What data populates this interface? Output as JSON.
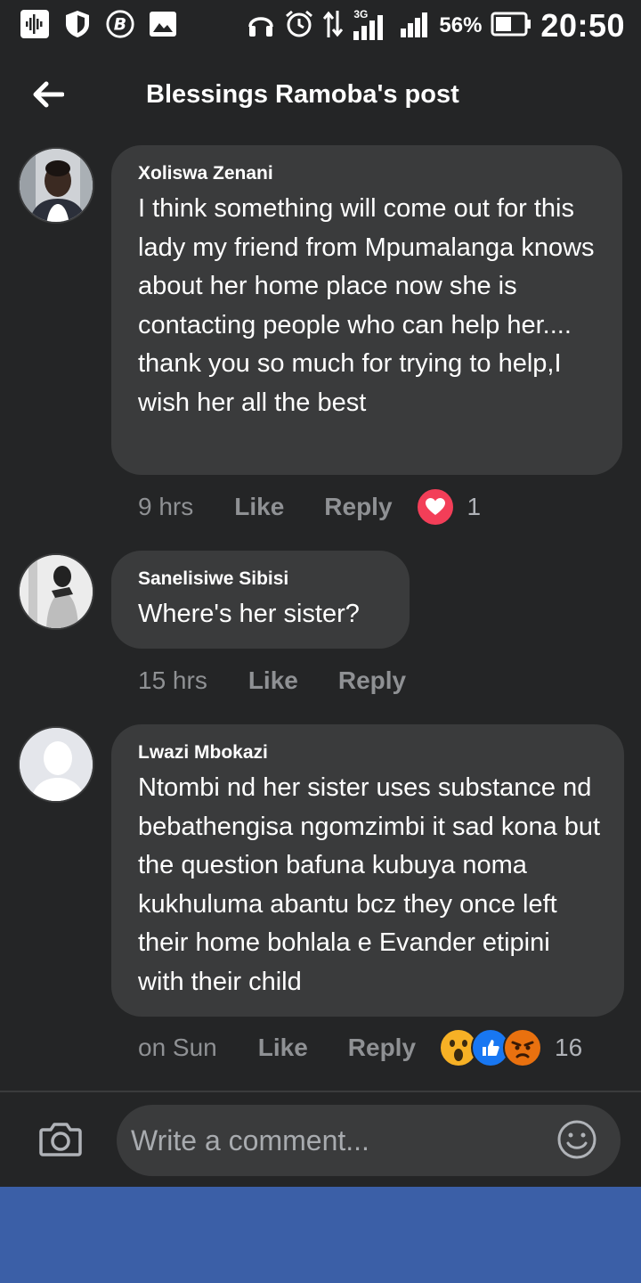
{
  "status_bar": {
    "network_label": "3G",
    "battery_percent": "56%",
    "battery_level": 0.56,
    "time": "20:50"
  },
  "header": {
    "title": "Blessings Ramoba's post",
    "back_icon": "arrow-left-icon"
  },
  "comments": [
    {
      "author": "Xoliswa Zenani",
      "text": "I think something will come out for this lady my friend from Mpumalanga knows about her home place now she is contacting people who can help her.... thank you so much for trying to help,I wish her all the best",
      "time": "9 hrs",
      "like_label": "Like",
      "reply_label": "Reply",
      "reactions": [
        "love"
      ],
      "reaction_count": "1"
    },
    {
      "author": "Sanelisiwe Sibisi",
      "text": "Where's her sister?",
      "time": "15 hrs",
      "like_label": "Like",
      "reply_label": "Reply",
      "reactions": [],
      "reaction_count": ""
    },
    {
      "author": "Lwazi Mbokazi",
      "text": "Ntombi nd her sister uses substance nd bebathengisa ngomzimbi it sad kona but the question bafuna kubuya noma kukhuluma abantu bcz they once left their home bohlala e Evander etipini with their child",
      "time": "on Sun",
      "like_label": "Like",
      "reply_label": "Reply",
      "reactions": [
        "wow",
        "like",
        "angry"
      ],
      "reaction_count": "16"
    }
  ],
  "composer": {
    "placeholder": "Write a comment...",
    "camera_icon": "camera-icon",
    "emoji_icon": "smiley-icon"
  },
  "colors": {
    "background": "#242526",
    "bubble": "#3a3b3c",
    "meta_text": "#8f9194",
    "love": "#f33e58",
    "like": "#1877f2",
    "wow": "#f7b125",
    "angry": "#e9710f",
    "bottom_band": "#3b5fa7"
  }
}
